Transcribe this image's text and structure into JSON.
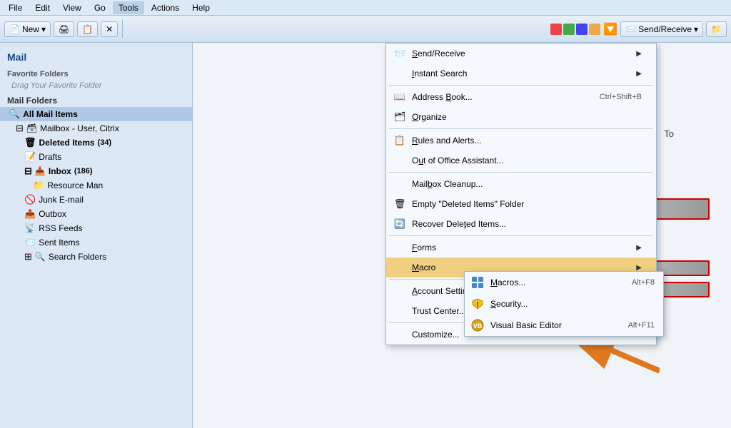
{
  "menubar": {
    "items": [
      "File",
      "Edit",
      "View",
      "Go",
      "Tools",
      "Actions",
      "Help"
    ]
  },
  "toolbar": {
    "new_label": "New",
    "send_receive_label": "Send/Receive",
    "to_label": "To"
  },
  "sidebar": {
    "mail_title": "Mail",
    "favorite_folders_title": "Favorite Folders",
    "drag_text": "Drag Your Favorite Folder",
    "mail_folders_title": "Mail Folders",
    "all_mail_items_label": "All Mail Items",
    "mailbox_label": "Mailbox - User, Citrix",
    "deleted_items_label": "Deleted Items",
    "deleted_count": "(34)",
    "drafts_label": "Drafts",
    "inbox_label": "Inbox",
    "inbox_count": "(186)",
    "resource_man_label": "Resource Man",
    "junk_email_label": "Junk E-mail",
    "outbox_label": "Outbox",
    "rss_feeds_label": "RSS Feeds",
    "sent_items_label": "Sent Items",
    "search_folders_label": "Search Folders"
  },
  "tools_menu": {
    "items": [
      {
        "id": "send_receive",
        "label": "Send/Receive",
        "has_arrow": true,
        "icon": ""
      },
      {
        "id": "instant_search",
        "label": "Instant Search",
        "has_arrow": true,
        "icon": ""
      },
      {
        "id": "address_book",
        "label": "Address Book...",
        "shortcut": "Ctrl+Shift+B",
        "icon": "📖"
      },
      {
        "id": "organize",
        "label": "Organize",
        "icon": "🗂"
      },
      {
        "id": "rules_alerts",
        "label": "Rules and Alerts...",
        "icon": "📋"
      },
      {
        "id": "out_of_office",
        "label": "Out of Office Assistant...",
        "icon": ""
      },
      {
        "id": "mailbox_cleanup",
        "label": "Mailbox Cleanup...",
        "icon": ""
      },
      {
        "id": "empty_deleted",
        "label": "Empty \"Deleted Items\" Folder",
        "icon": "🗑"
      },
      {
        "id": "recover_deleted",
        "label": "Recover Deleted Items...",
        "icon": "🔄"
      },
      {
        "id": "forms",
        "label": "Forms",
        "has_arrow": true,
        "icon": ""
      },
      {
        "id": "macro",
        "label": "Macro",
        "highlighted": true,
        "has_arrow": true,
        "icon": ""
      },
      {
        "id": "account_settings",
        "label": "Account Settings...",
        "icon": ""
      },
      {
        "id": "trust_center",
        "label": "Trust Center...",
        "icon": ""
      },
      {
        "id": "customize",
        "label": "Customize...",
        "icon": ""
      }
    ]
  },
  "macro_submenu": {
    "items": [
      {
        "id": "macros",
        "label": "Macros...",
        "shortcut": "Alt+F8",
        "icon": "grid"
      },
      {
        "id": "security",
        "label": "Security...",
        "icon": "warning"
      },
      {
        "id": "vb_editor",
        "label": "Visual Basic Editor",
        "shortcut": "Alt+F11",
        "icon": "vb"
      }
    ]
  }
}
